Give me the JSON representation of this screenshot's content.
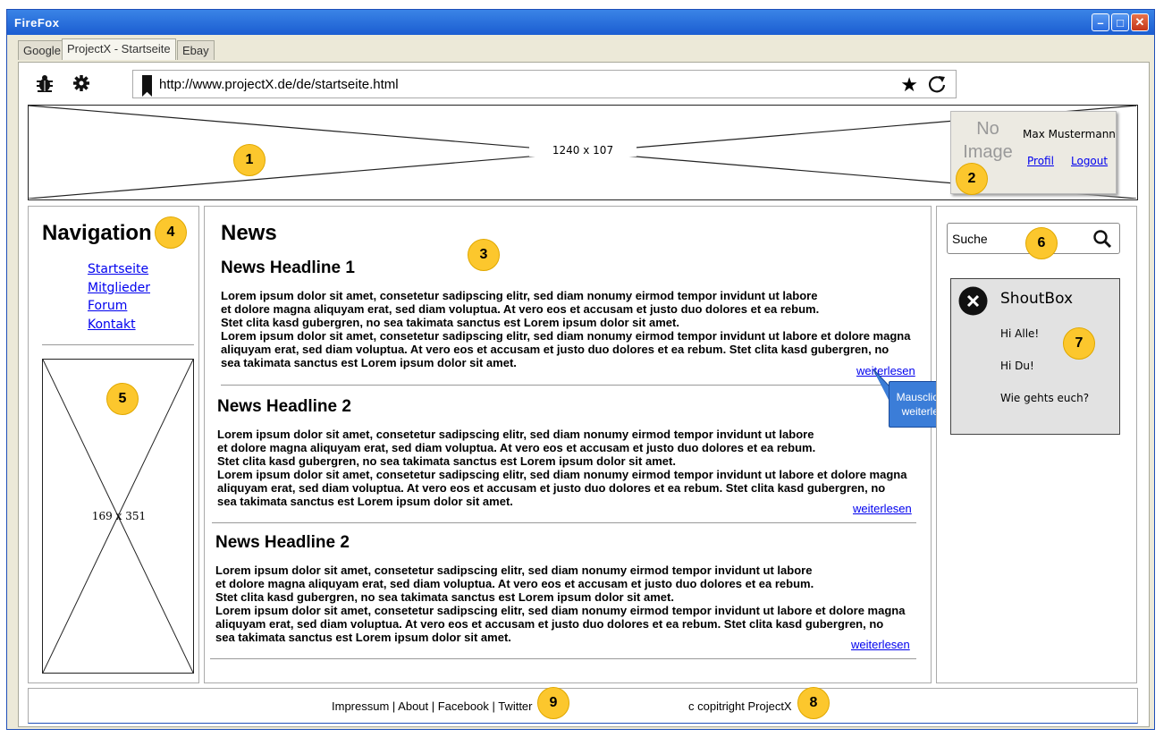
{
  "window": {
    "title": "FireFox"
  },
  "tabs": [
    {
      "label": "Google"
    },
    {
      "label": "ProjectX - Startseite"
    },
    {
      "label": "Ebay"
    }
  ],
  "toolbar": {
    "url": "http://www.projectX.de/de/startseite.html"
  },
  "header": {
    "banner_label": "1240 x 107",
    "no_image_label": "No Image",
    "user_name": "Max Mustermann",
    "profile_link": "Profil",
    "logout_link": "Logout"
  },
  "navigation": {
    "title": "Navigation",
    "items": [
      {
        "label": "Startseite"
      },
      {
        "label": "Mitglieder"
      },
      {
        "label": "Forum"
      },
      {
        "label": "Kontakt"
      }
    ],
    "image_label": "169 x 351"
  },
  "news": {
    "title": "News",
    "items": [
      {
        "headline": "News Headline 1",
        "lines": [
          "Lorem ipsum dolor sit amet, consetetur sadipscing elitr, sed diam nonumy eirmod tempor invidunt ut labore",
          "et dolore magna aliquyam erat, sed diam voluptua. At vero eos et accusam et justo duo dolores et ea rebum.",
          "Stet clita kasd gubergren, no sea takimata sanctus est Lorem ipsum dolor sit amet.",
          "Lorem ipsum dolor sit amet, consetetur sadipscing elitr, sed diam nonumy eirmod tempor invidunt ut labore et dolore magna",
          "aliquyam erat, sed diam voluptua. At vero eos et accusam et justo duo dolores et ea rebum. Stet clita kasd gubergren, no",
          "sea takimata sanctus est Lorem ipsum dolor sit amet."
        ],
        "more": "weiterlesen"
      },
      {
        "headline": "News Headline 2",
        "lines": [
          "Lorem ipsum dolor sit amet, consetetur sadipscing elitr, sed diam nonumy eirmod tempor invidunt ut labore",
          "et dolore magna aliquyam erat, sed diam voluptua. At vero eos et accusam et justo duo dolores et ea rebum.",
          "Stet clita kasd gubergren, no sea takimata sanctus est Lorem ipsum dolor sit amet.",
          "Lorem ipsum dolor sit amet, consetetur sadipscing elitr, sed diam nonumy eirmod tempor invidunt ut labore et dolore magna",
          "aliquyam erat, sed diam voluptua. At vero eos et accusam et justo duo dolores et ea rebum. Stet clita kasd gubergren, no",
          "sea takimata sanctus est Lorem ipsum dolor sit amet."
        ],
        "more": "weiterlesen"
      },
      {
        "headline": "News Headline 2",
        "lines": [
          "Lorem ipsum dolor sit amet, consetetur sadipscing elitr, sed diam nonumy eirmod tempor invidunt ut labore",
          "et dolore magna aliquyam erat, sed diam voluptua. At vero eos et accusam et justo duo dolores et ea rebum.",
          "Stet clita kasd gubergren, no sea takimata sanctus est Lorem ipsum dolor sit amet.",
          "Lorem ipsum dolor sit amet, consetetur sadipscing elitr, sed diam nonumy eirmod tempor invidunt ut labore et dolore magna",
          "aliquyam erat, sed diam voluptua. At vero eos et accusam et justo duo dolores et ea rebum. Stet clita kasd gubergren, no",
          "sea takimata sanctus est Lorem ipsum dolor sit amet."
        ],
        "more": "weiterlesen"
      }
    ],
    "callout": "Mausclick auf weiterlesen"
  },
  "sidebar": {
    "search_placeholder": "Suche",
    "shoutbox": {
      "title": "ShoutBox",
      "messages": [
        {
          "text": "Hi Alle!"
        },
        {
          "text": "Hi Du!"
        },
        {
          "text": "Wie gehts euch?"
        }
      ]
    }
  },
  "footer": {
    "links": "Impressum | About | Facebook | Twitter",
    "copyright": "c copitright ProjectX"
  },
  "markers": [
    "1",
    "2",
    "3",
    "4",
    "5",
    "6",
    "7",
    "8",
    "9"
  ],
  "colors": {
    "marker": "#fcc72d",
    "titlebar": "#1b5dd1",
    "callout": "#3b7dd8"
  }
}
